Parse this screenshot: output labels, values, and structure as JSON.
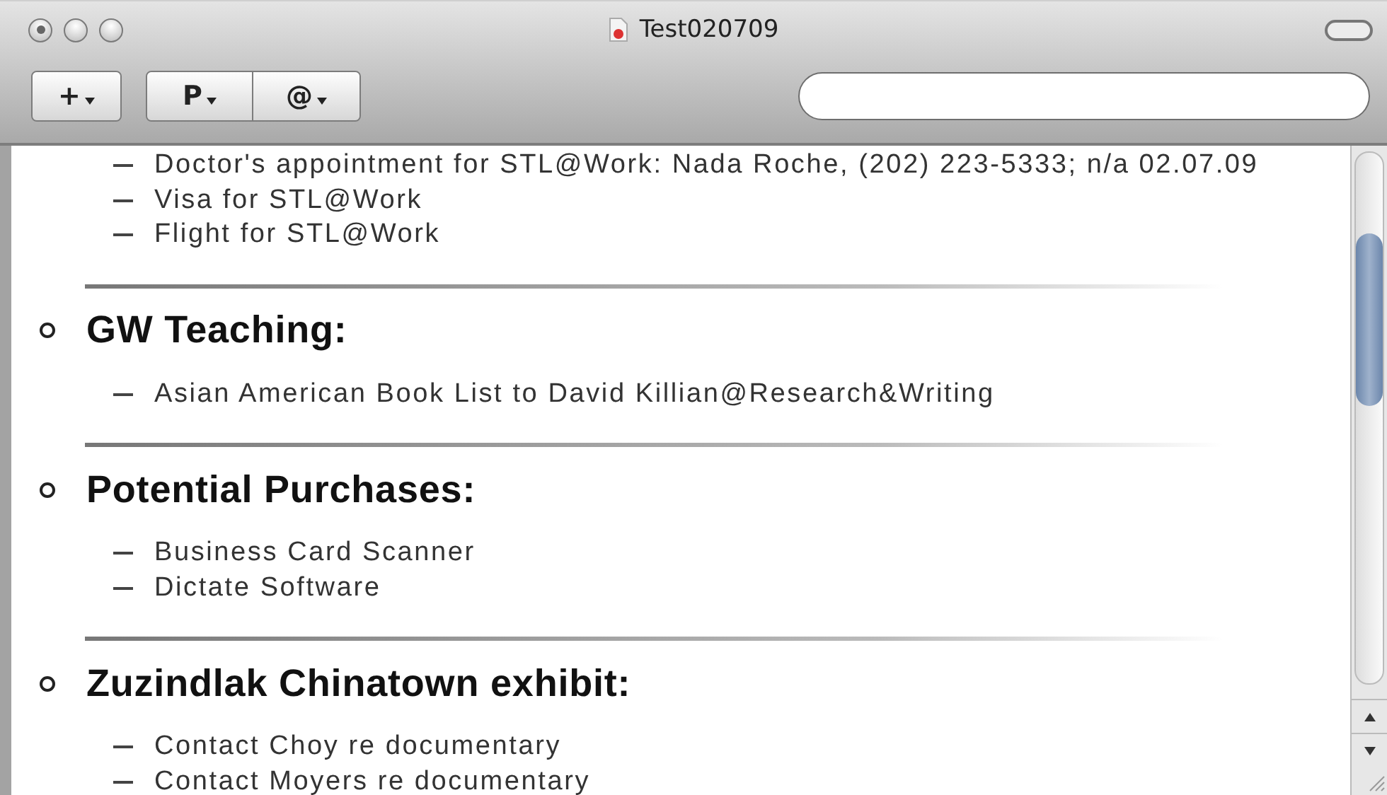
{
  "window": {
    "title": "Test020709"
  },
  "toolbar": {
    "groups": [
      {
        "buttons": [
          {
            "label": "+"
          }
        ]
      },
      {
        "buttons": [
          {
            "label": "P"
          },
          {
            "label": "@"
          }
        ]
      }
    ]
  },
  "sections": [
    {
      "items": [
        "Doctor's appointment for STL@Work: Nada Roche, (202) 223-5333; n/a 02.07.09",
        "Visa for STL@Work",
        "Flight for STL@Work"
      ]
    },
    {
      "heading": "GW Teaching:",
      "items": [
        "Asian American Book List to David Killian@Research&Writing"
      ]
    },
    {
      "heading": "Potential Purchases:",
      "items": [
        "Business Card Scanner",
        "Dictate Software"
      ]
    },
    {
      "heading": "Zuzindlak Chinatown exhibit:",
      "items": [
        "Contact Choy re documentary",
        "Contact Moyers re documentary"
      ]
    }
  ]
}
